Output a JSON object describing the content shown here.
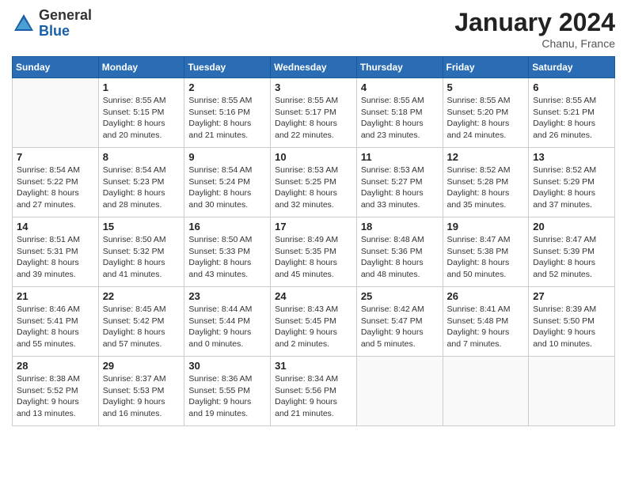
{
  "header": {
    "logo_general": "General",
    "logo_blue": "Blue",
    "title": "January 2024",
    "location": "Chanu, France"
  },
  "days_of_week": [
    "Sunday",
    "Monday",
    "Tuesday",
    "Wednesday",
    "Thursday",
    "Friday",
    "Saturday"
  ],
  "weeks": [
    [
      {
        "day": "",
        "sunrise": "",
        "sunset": "",
        "daylight": ""
      },
      {
        "day": "1",
        "sunrise": "Sunrise: 8:55 AM",
        "sunset": "Sunset: 5:15 PM",
        "daylight": "Daylight: 8 hours and 20 minutes."
      },
      {
        "day": "2",
        "sunrise": "Sunrise: 8:55 AM",
        "sunset": "Sunset: 5:16 PM",
        "daylight": "Daylight: 8 hours and 21 minutes."
      },
      {
        "day": "3",
        "sunrise": "Sunrise: 8:55 AM",
        "sunset": "Sunset: 5:17 PM",
        "daylight": "Daylight: 8 hours and 22 minutes."
      },
      {
        "day": "4",
        "sunrise": "Sunrise: 8:55 AM",
        "sunset": "Sunset: 5:18 PM",
        "daylight": "Daylight: 8 hours and 23 minutes."
      },
      {
        "day": "5",
        "sunrise": "Sunrise: 8:55 AM",
        "sunset": "Sunset: 5:20 PM",
        "daylight": "Daylight: 8 hours and 24 minutes."
      },
      {
        "day": "6",
        "sunrise": "Sunrise: 8:55 AM",
        "sunset": "Sunset: 5:21 PM",
        "daylight": "Daylight: 8 hours and 26 minutes."
      }
    ],
    [
      {
        "day": "7",
        "sunrise": "Sunrise: 8:54 AM",
        "sunset": "Sunset: 5:22 PM",
        "daylight": "Daylight: 8 hours and 27 minutes."
      },
      {
        "day": "8",
        "sunrise": "Sunrise: 8:54 AM",
        "sunset": "Sunset: 5:23 PM",
        "daylight": "Daylight: 8 hours and 28 minutes."
      },
      {
        "day": "9",
        "sunrise": "Sunrise: 8:54 AM",
        "sunset": "Sunset: 5:24 PM",
        "daylight": "Daylight: 8 hours and 30 minutes."
      },
      {
        "day": "10",
        "sunrise": "Sunrise: 8:53 AM",
        "sunset": "Sunset: 5:25 PM",
        "daylight": "Daylight: 8 hours and 32 minutes."
      },
      {
        "day": "11",
        "sunrise": "Sunrise: 8:53 AM",
        "sunset": "Sunset: 5:27 PM",
        "daylight": "Daylight: 8 hours and 33 minutes."
      },
      {
        "day": "12",
        "sunrise": "Sunrise: 8:52 AM",
        "sunset": "Sunset: 5:28 PM",
        "daylight": "Daylight: 8 hours and 35 minutes."
      },
      {
        "day": "13",
        "sunrise": "Sunrise: 8:52 AM",
        "sunset": "Sunset: 5:29 PM",
        "daylight": "Daylight: 8 hours and 37 minutes."
      }
    ],
    [
      {
        "day": "14",
        "sunrise": "Sunrise: 8:51 AM",
        "sunset": "Sunset: 5:31 PM",
        "daylight": "Daylight: 8 hours and 39 minutes."
      },
      {
        "day": "15",
        "sunrise": "Sunrise: 8:50 AM",
        "sunset": "Sunset: 5:32 PM",
        "daylight": "Daylight: 8 hours and 41 minutes."
      },
      {
        "day": "16",
        "sunrise": "Sunrise: 8:50 AM",
        "sunset": "Sunset: 5:33 PM",
        "daylight": "Daylight: 8 hours and 43 minutes."
      },
      {
        "day": "17",
        "sunrise": "Sunrise: 8:49 AM",
        "sunset": "Sunset: 5:35 PM",
        "daylight": "Daylight: 8 hours and 45 minutes."
      },
      {
        "day": "18",
        "sunrise": "Sunrise: 8:48 AM",
        "sunset": "Sunset: 5:36 PM",
        "daylight": "Daylight: 8 hours and 48 minutes."
      },
      {
        "day": "19",
        "sunrise": "Sunrise: 8:47 AM",
        "sunset": "Sunset: 5:38 PM",
        "daylight": "Daylight: 8 hours and 50 minutes."
      },
      {
        "day": "20",
        "sunrise": "Sunrise: 8:47 AM",
        "sunset": "Sunset: 5:39 PM",
        "daylight": "Daylight: 8 hours and 52 minutes."
      }
    ],
    [
      {
        "day": "21",
        "sunrise": "Sunrise: 8:46 AM",
        "sunset": "Sunset: 5:41 PM",
        "daylight": "Daylight: 8 hours and 55 minutes."
      },
      {
        "day": "22",
        "sunrise": "Sunrise: 8:45 AM",
        "sunset": "Sunset: 5:42 PM",
        "daylight": "Daylight: 8 hours and 57 minutes."
      },
      {
        "day": "23",
        "sunrise": "Sunrise: 8:44 AM",
        "sunset": "Sunset: 5:44 PM",
        "daylight": "Daylight: 9 hours and 0 minutes."
      },
      {
        "day": "24",
        "sunrise": "Sunrise: 8:43 AM",
        "sunset": "Sunset: 5:45 PM",
        "daylight": "Daylight: 9 hours and 2 minutes."
      },
      {
        "day": "25",
        "sunrise": "Sunrise: 8:42 AM",
        "sunset": "Sunset: 5:47 PM",
        "daylight": "Daylight: 9 hours and 5 minutes."
      },
      {
        "day": "26",
        "sunrise": "Sunrise: 8:41 AM",
        "sunset": "Sunset: 5:48 PM",
        "daylight": "Daylight: 9 hours and 7 minutes."
      },
      {
        "day": "27",
        "sunrise": "Sunrise: 8:39 AM",
        "sunset": "Sunset: 5:50 PM",
        "daylight": "Daylight: 9 hours and 10 minutes."
      }
    ],
    [
      {
        "day": "28",
        "sunrise": "Sunrise: 8:38 AM",
        "sunset": "Sunset: 5:52 PM",
        "daylight": "Daylight: 9 hours and 13 minutes."
      },
      {
        "day": "29",
        "sunrise": "Sunrise: 8:37 AM",
        "sunset": "Sunset: 5:53 PM",
        "daylight": "Daylight: 9 hours and 16 minutes."
      },
      {
        "day": "30",
        "sunrise": "Sunrise: 8:36 AM",
        "sunset": "Sunset: 5:55 PM",
        "daylight": "Daylight: 9 hours and 19 minutes."
      },
      {
        "day": "31",
        "sunrise": "Sunrise: 8:34 AM",
        "sunset": "Sunset: 5:56 PM",
        "daylight": "Daylight: 9 hours and 21 minutes."
      },
      {
        "day": "",
        "sunrise": "",
        "sunset": "",
        "daylight": ""
      },
      {
        "day": "",
        "sunrise": "",
        "sunset": "",
        "daylight": ""
      },
      {
        "day": "",
        "sunrise": "",
        "sunset": "",
        "daylight": ""
      }
    ]
  ]
}
